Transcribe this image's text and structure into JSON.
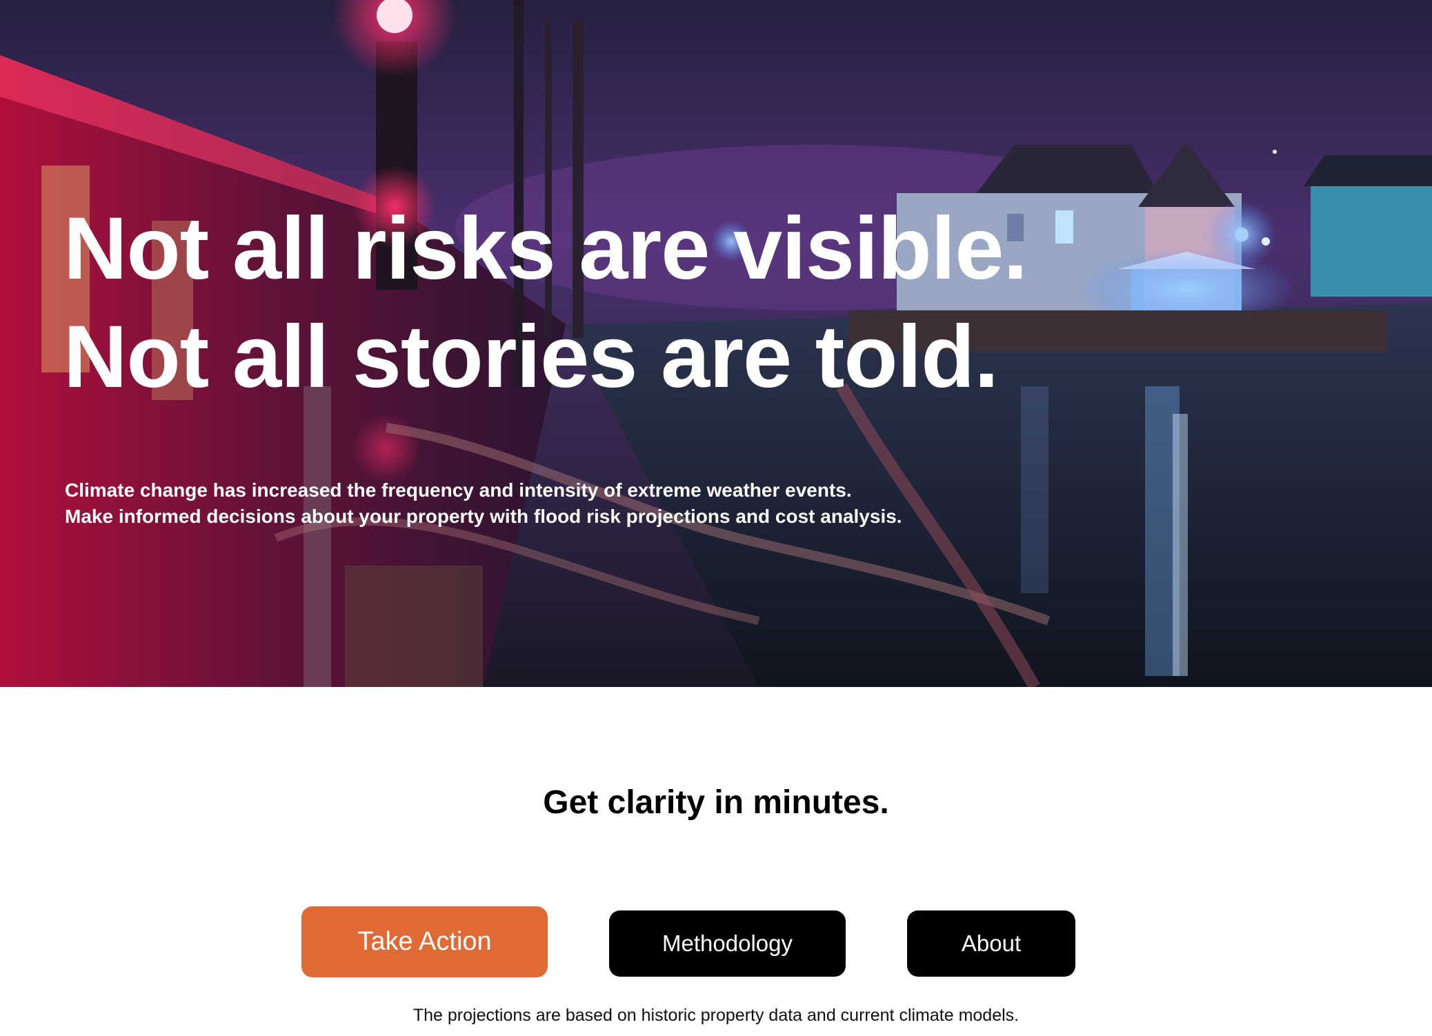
{
  "hero": {
    "headline_line1": "Not all risks are visible.",
    "headline_line2": "Not all stories are told.",
    "subtext_line1": "Climate change has increased the frequency and intensity of extreme weather events.",
    "subtext_line2": "Make informed decisions about your property with flood risk projections and cost analysis.",
    "background_image": "night flooded street with train and houses"
  },
  "main": {
    "tagline": "Get clarity in minutes.",
    "buttons": {
      "take_action": "Take Action",
      "methodology": "Methodology",
      "about": "About"
    },
    "footnote": "The projections are based on historic property data and current climate models."
  },
  "colors": {
    "accent": "#e06a35",
    "button_dark": "#000000",
    "text_light": "#ffffff"
  }
}
